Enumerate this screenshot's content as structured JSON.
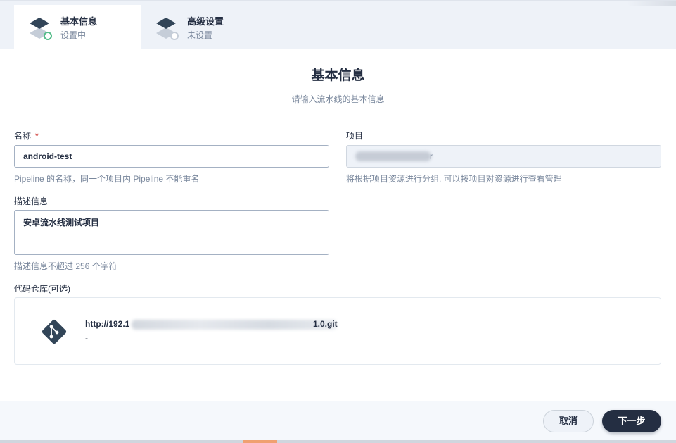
{
  "steps": [
    {
      "title": "基本信息",
      "status": "设置中"
    },
    {
      "title": "高级设置",
      "status": "未设置"
    }
  ],
  "header": {
    "title": "基本信息",
    "description": "请输入流水线的基本信息"
  },
  "form": {
    "name": {
      "label": "名称",
      "required_mark": "*",
      "value": "android-test",
      "hint": "Pipeline 的名称，同一个项目内 Pipeline 不能重名"
    },
    "project": {
      "label": "项目",
      "value_tail": "r",
      "hint": "将根据项目资源进行分组, 可以按项目对资源进行查看管理"
    },
    "description": {
      "label": "描述信息",
      "value": "安卓流水线测试项目",
      "hint": "描述信息不超过 256 个字符"
    },
    "repository": {
      "label": "代码仓库(可选)",
      "url_prefix": "http://192.1",
      "url_suffix": "1.0.git",
      "branch": "-",
      "icon": "git-icon"
    }
  },
  "footer": {
    "cancel_label": "取消",
    "next_label": "下一步"
  },
  "colors": {
    "primary_dark": "#242e42",
    "step_active_ring": "#55bc8a",
    "required": "#ca2621",
    "muted_text": "#79879c"
  }
}
